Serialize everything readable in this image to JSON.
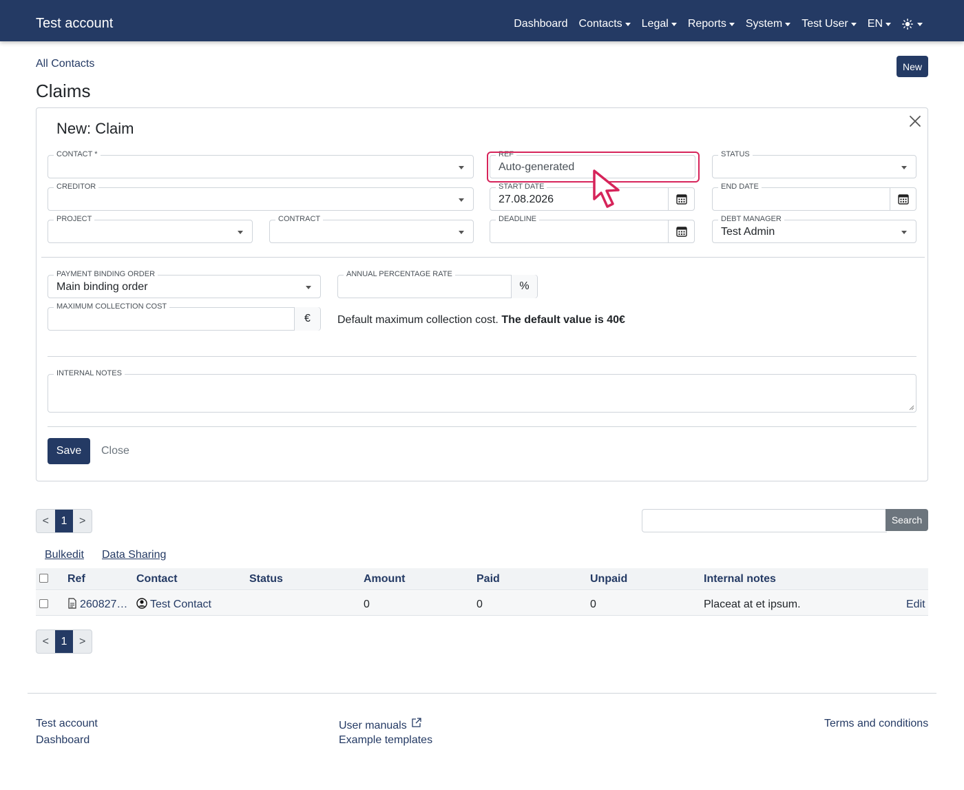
{
  "navbar": {
    "brand": "Test account",
    "items": [
      {
        "label": "Dashboard",
        "dropdown": false
      },
      {
        "label": "Contacts",
        "dropdown": true
      },
      {
        "label": "Legal",
        "dropdown": true
      },
      {
        "label": "Reports",
        "dropdown": true
      },
      {
        "label": "System",
        "dropdown": true
      },
      {
        "label": "Test User",
        "dropdown": true
      },
      {
        "label": "EN",
        "dropdown": true
      }
    ],
    "theme_icon": "sun-icon"
  },
  "breadcrumb": "All Contacts",
  "page_title": "Claims",
  "new_button": "New",
  "form": {
    "title": "New: Claim",
    "contact": {
      "label": "Contact *",
      "value": ""
    },
    "ref": {
      "label": "Ref",
      "placeholder": "Auto-generated"
    },
    "status": {
      "label": "Status",
      "value": ""
    },
    "creditor": {
      "label": "Creditor",
      "value": ""
    },
    "start_date": {
      "label": "Start date",
      "value": "27.08.2026"
    },
    "end_date": {
      "label": "End date",
      "value": ""
    },
    "project": {
      "label": "Project",
      "value": ""
    },
    "contract": {
      "label": "Contract",
      "value": ""
    },
    "deadline": {
      "label": "Deadline",
      "value": ""
    },
    "debt_manager": {
      "label": "Debt manager",
      "value": "Test Admin"
    },
    "payment_binding_order": {
      "label": "Payment binding order",
      "value": "Main binding order"
    },
    "annual_percentage_rate": {
      "label": "Annual percentage rate",
      "value": "",
      "unit": "%"
    },
    "max_collection_cost": {
      "label": "Maximum collection cost",
      "value": "",
      "unit": "€"
    },
    "help_text": "Default maximum collection cost.",
    "help_bold": "The default value is 40€",
    "internal_notes": {
      "label": "Internal notes",
      "value": ""
    },
    "save_label": "Save",
    "close_label": "Close"
  },
  "pagination": {
    "prev": "<",
    "current": "1",
    "next": ">"
  },
  "search": {
    "button": "Search",
    "value": ""
  },
  "table_links": {
    "bulkedit": "Bulkedit",
    "data_sharing": "Data Sharing"
  },
  "table": {
    "headers": {
      "ref": "Ref",
      "contact": "Contact",
      "status": "Status",
      "amount": "Amount",
      "paid": "Paid",
      "unpaid": "Unpaid",
      "internal_notes": "Internal notes"
    },
    "rows": [
      {
        "ref": "260827…",
        "contact": "Test Contact",
        "status": "",
        "amount": "0",
        "paid": "0",
        "unpaid": "0",
        "internal_notes": "Placeat at et ipsum.",
        "edit": "Edit"
      }
    ]
  },
  "footer": {
    "col1": [
      "Test account",
      "Dashboard"
    ],
    "col2": [
      "User manuals",
      "Example templates"
    ],
    "col3": [
      "Terms and conditions"
    ]
  },
  "colors": {
    "brand": "#243a64",
    "highlight": "#d6245a"
  }
}
